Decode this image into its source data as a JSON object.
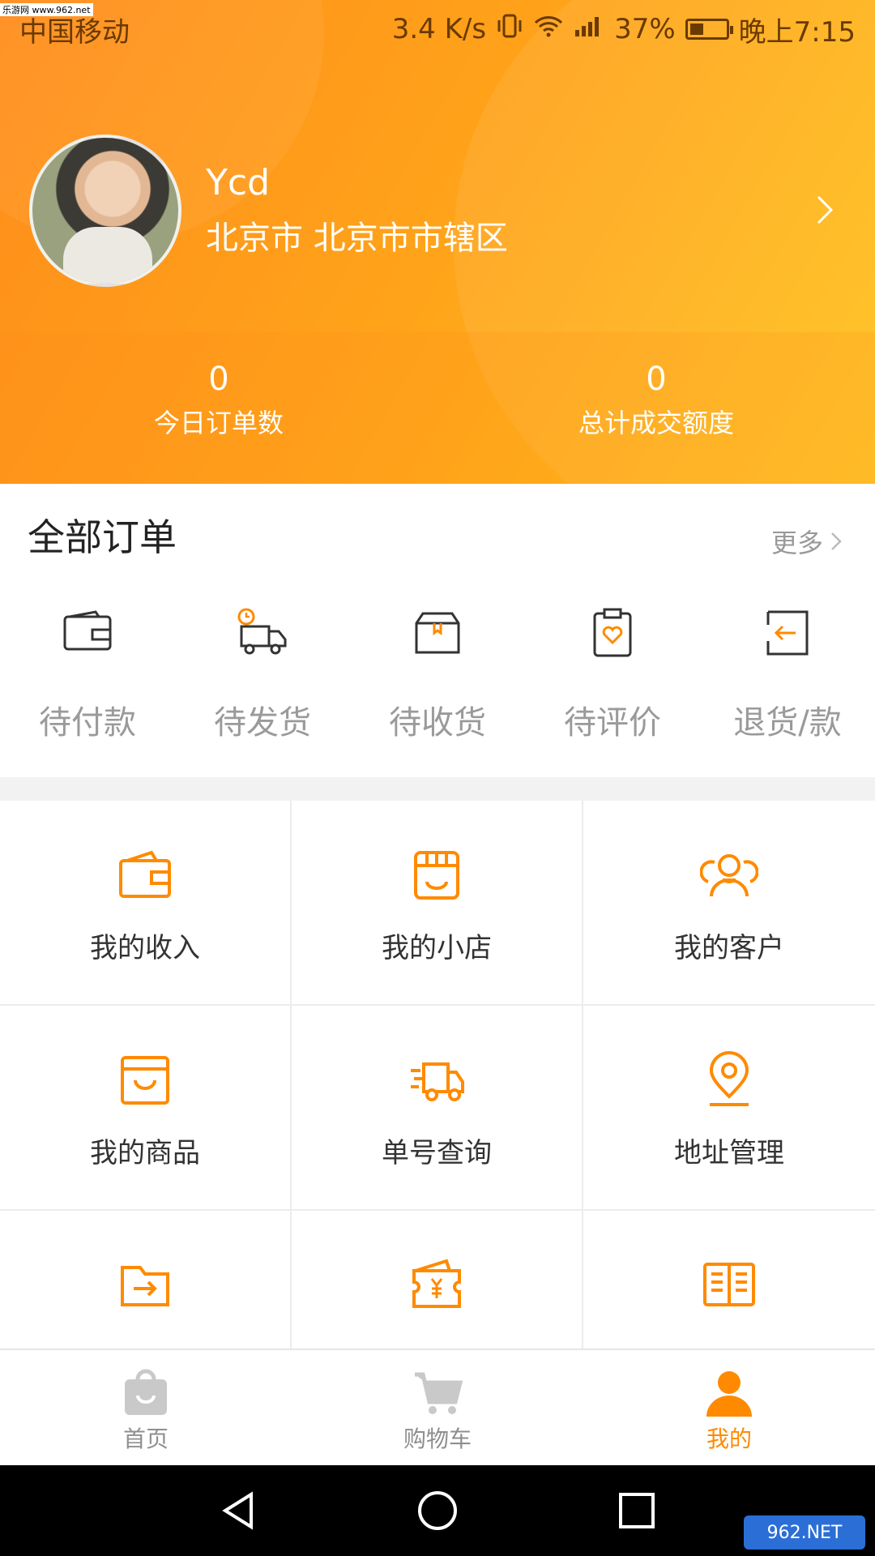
{
  "watermark": "乐游网 www.962.net",
  "status_bar": {
    "carrier": "中国移动",
    "speed": "3.4 K/s",
    "battery_pct": "37%",
    "time": "晚上7:15"
  },
  "profile": {
    "name": "Ycd",
    "location": "北京市 北京市市辖区"
  },
  "stats": [
    {
      "value": "0",
      "label": "今日订单数"
    },
    {
      "value": "0",
      "label": "总计成交额度"
    }
  ],
  "orders": {
    "title": "全部订单",
    "more_label": "更多",
    "items": [
      {
        "label": "待付款",
        "icon": "wallet-icon"
      },
      {
        "label": "待发货",
        "icon": "truck-clock-icon"
      },
      {
        "label": "待收货",
        "icon": "box-icon"
      },
      {
        "label": "待评价",
        "icon": "clipboard-heart-icon"
      },
      {
        "label": "退货/款",
        "icon": "return-icon"
      }
    ]
  },
  "grid": [
    {
      "label": "我的收入",
      "icon": "wallet-orange-icon"
    },
    {
      "label": "我的小店",
      "icon": "store-icon"
    },
    {
      "label": "我的客户",
      "icon": "customers-icon"
    },
    {
      "label": "我的商品",
      "icon": "shopping-bag-icon"
    },
    {
      "label": "单号查询",
      "icon": "delivery-truck-icon"
    },
    {
      "label": "地址管理",
      "icon": "location-pin-icon"
    },
    {
      "label": "",
      "icon": "folder-arrow-icon"
    },
    {
      "label": "",
      "icon": "coupon-yen-icon"
    },
    {
      "label": "",
      "icon": "book-icon"
    }
  ],
  "tabs": [
    {
      "label": "首页",
      "icon": "home-bag-icon",
      "active": false
    },
    {
      "label": "购物车",
      "icon": "cart-icon",
      "active": false
    },
    {
      "label": "我的",
      "icon": "person-icon",
      "active": true
    }
  ],
  "colors": {
    "accent": "#ff8a00",
    "header_start": "#ff8c1a",
    "header_end": "#ffc21a"
  },
  "brand": "962.NET"
}
